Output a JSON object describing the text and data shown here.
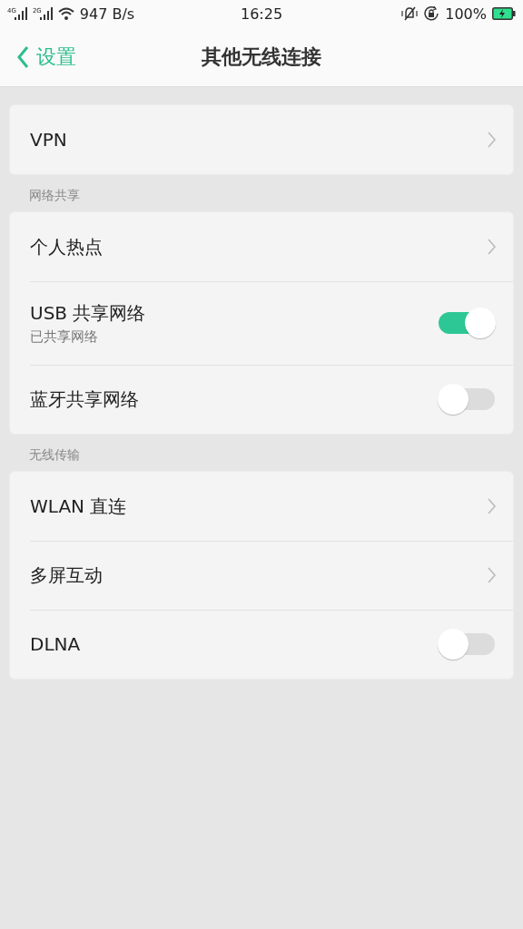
{
  "status_bar": {
    "network_labels": [
      "4G",
      "2G"
    ],
    "speed": "947 B/s",
    "time": "16:25",
    "battery": "100%"
  },
  "nav": {
    "back": "设置",
    "title": "其他无线连接"
  },
  "sections": [
    {
      "rows": [
        {
          "kind": "link",
          "label": "VPN"
        }
      ]
    },
    {
      "header": "网络共享",
      "rows": [
        {
          "kind": "link",
          "label": "个人热点"
        },
        {
          "kind": "switch",
          "label": "USB 共享网络",
          "subtitle": "已共享网络",
          "on": true
        },
        {
          "kind": "switch",
          "label": "蓝牙共享网络",
          "on": false
        }
      ]
    },
    {
      "header": "无线传输",
      "rows": [
        {
          "kind": "link",
          "label": "WLAN 直连"
        },
        {
          "kind": "link",
          "label": "多屏互动"
        },
        {
          "kind": "switch",
          "label": "DLNA",
          "on": false
        }
      ]
    }
  ]
}
